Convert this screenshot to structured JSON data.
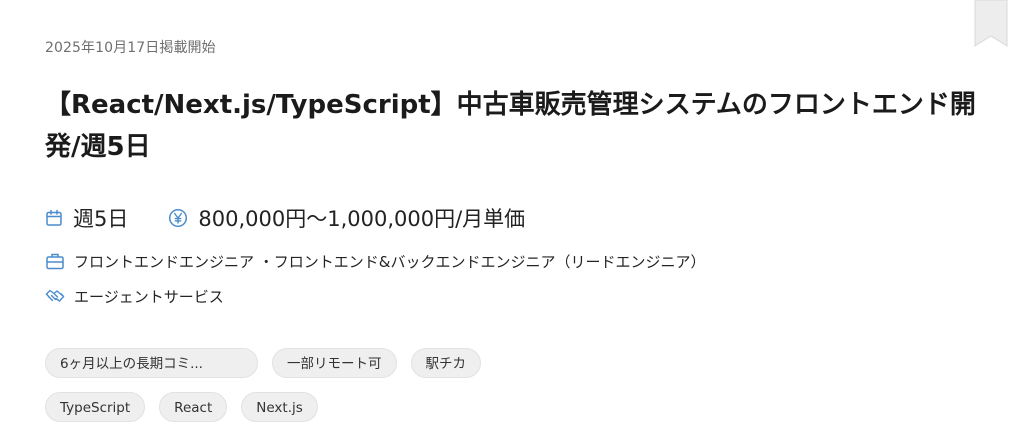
{
  "card": {
    "posted_date": "2025年10月17日掲載開始",
    "title": "【React/Next.js/TypeScript】中古車販売管理システムのフロントエンド開発/週5日",
    "schedule": "週5日",
    "salary": "800,000円〜1,000,000円/月単価",
    "job_types": "フロントエンドエンジニア ・フロントエンド&バックエンドエンジニア（リードエンジニア）",
    "agent": "エージェントサービス",
    "tags_row1": [
      "6ヶ月以上の長期コミ...",
      "一部リモート可",
      "駅チカ"
    ],
    "tags_row2": [
      "TypeScript",
      "React",
      "Next.js"
    ]
  },
  "icons": {
    "bookmark": "bookmark-icon",
    "schedule": "calendar-icon",
    "salary": "yen-icon",
    "job_types": "briefcase-icon",
    "agent": "handshake-icon"
  },
  "colors": {
    "icon_blue": "#4a8ccc",
    "tag_bg": "#efefef",
    "date_text": "#6f6f6f"
  }
}
